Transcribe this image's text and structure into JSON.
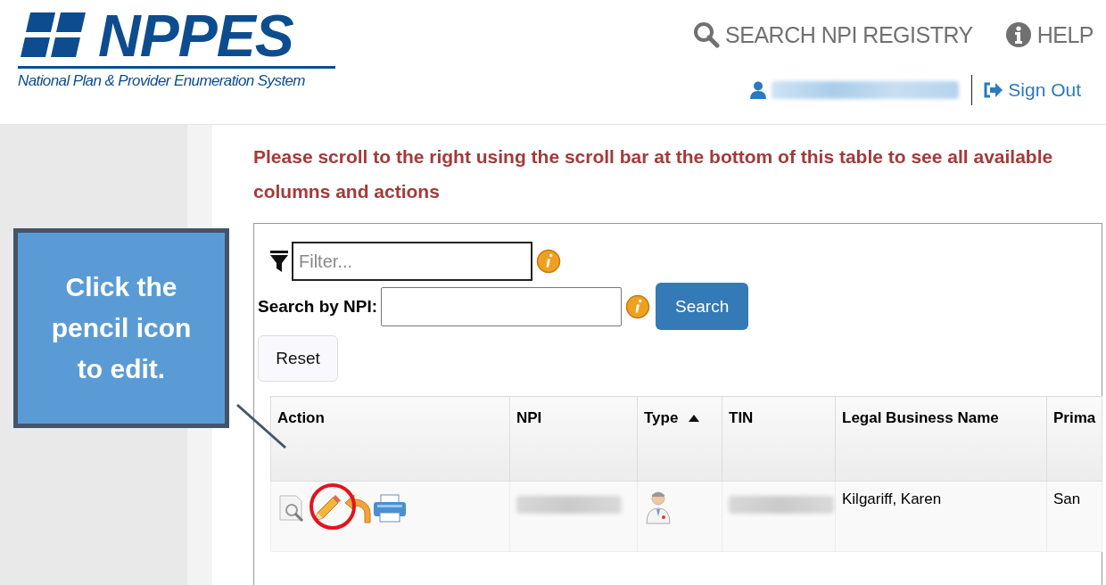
{
  "logo": {
    "title": "NPPES",
    "subtitle": "National Plan & Provider Enumeration System"
  },
  "nav": [
    {
      "label": "SEARCH NPI REGISTRY"
    },
    {
      "label": "HELP"
    }
  ],
  "user": {
    "sign_out": "Sign Out"
  },
  "notice": "Please scroll to the right using the scroll bar at the bottom of this table to see all available columns and actions",
  "filter": {
    "placeholder": "Filter..."
  },
  "npi_search": {
    "label": "Search by NPI:",
    "button": "Search"
  },
  "reset": "Reset",
  "table": {
    "columns": [
      {
        "label": "Action",
        "sorted": false
      },
      {
        "label": "NPI",
        "sorted": false
      },
      {
        "label": "Type",
        "sorted": true
      },
      {
        "label": "TIN",
        "sorted": false
      },
      {
        "label": "Legal Business Name",
        "sorted": false
      },
      {
        "label": "Prima",
        "sorted": false
      }
    ],
    "rows": [
      {
        "cells": [
          {
            "kind": "actions"
          },
          {
            "kind": "redacted"
          },
          {
            "kind": "individual"
          },
          {
            "kind": "redacted"
          },
          {
            "kind": "text",
            "text": "Kilgariff, Karen"
          },
          {
            "kind": "text",
            "text": "San"
          }
        ]
      }
    ]
  },
  "callout": {
    "text": "Click the pencil icon to edit."
  }
}
